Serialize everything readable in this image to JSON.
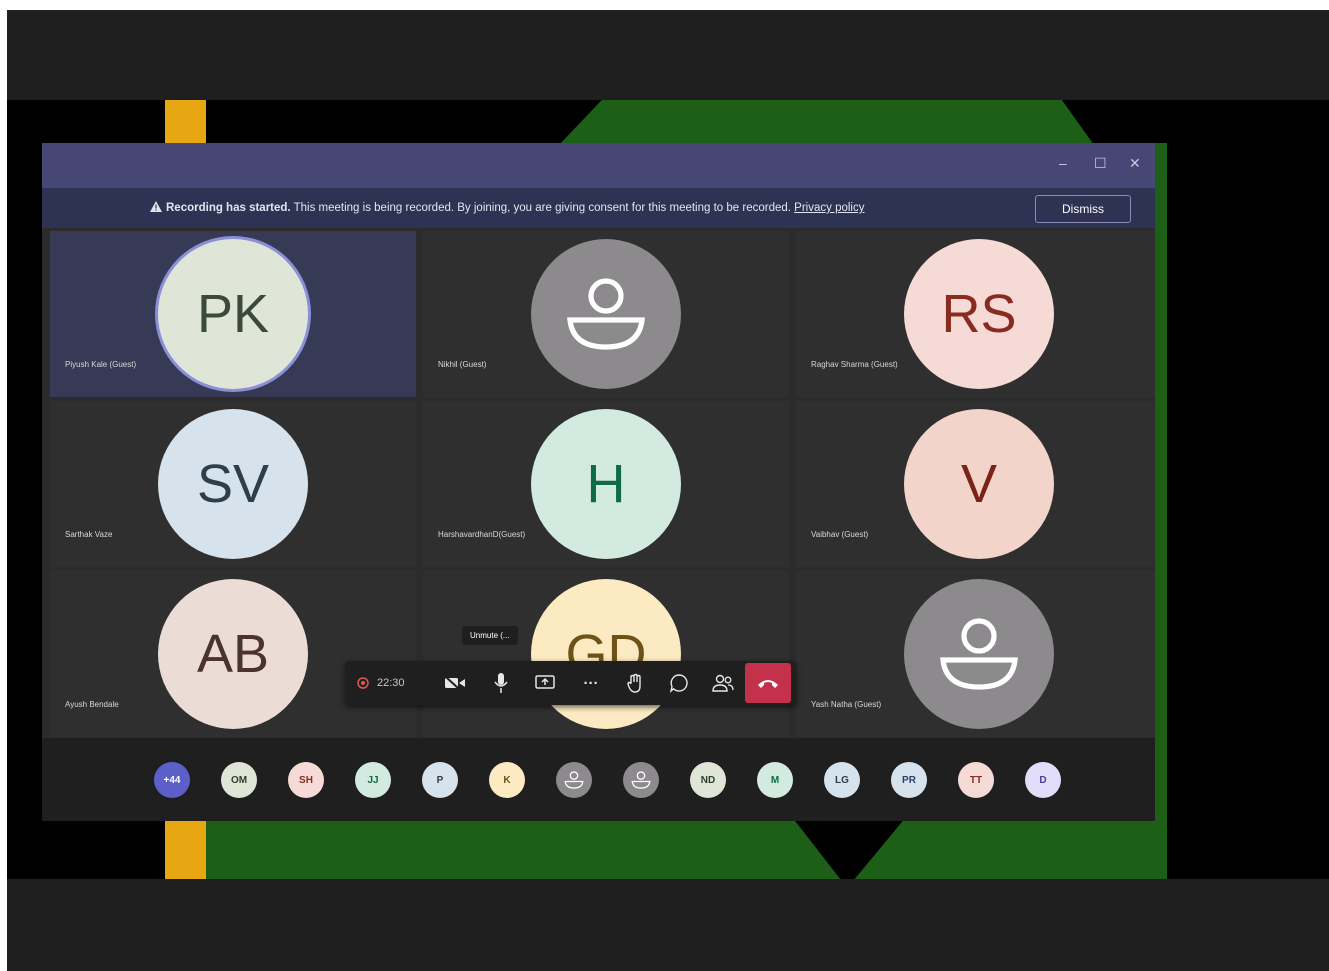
{
  "window": {
    "controls": {
      "minimize": "–",
      "maximize": "☐",
      "close": "✕"
    }
  },
  "banner": {
    "icon": "warning-icon",
    "title": "Recording has started.",
    "message": "This meeting is being recorded. By joining, you are giving consent for this meeting to be recorded.",
    "link": "Privacy policy",
    "dismiss_label": "Dismiss"
  },
  "participants": [
    {
      "initials": "PK",
      "name": "Piyush Kale (Guest)",
      "bg": "#dfe6d7",
      "fg": "#3c4a3c",
      "speaking": true
    },
    {
      "initials": "",
      "name": "Nikhil (Guest)",
      "bg": "#8c8a8c",
      "fg": "#ffffff",
      "icon": "person-icon"
    },
    {
      "initials": "RS",
      "name": "Raghav Sharma (Guest)",
      "bg": "#f6dad5",
      "fg": "#8a2b21"
    },
    {
      "initials": "SV",
      "name": "Sarthak Vaze",
      "bg": "#d7e3ec",
      "fg": "#2e3e4a"
    },
    {
      "initials": "H",
      "name": "HarshavardhanD(Guest)",
      "bg": "#d2eadf",
      "fg": "#0f6b45"
    },
    {
      "initials": "V",
      "name": "Vaibhav (Guest)",
      "bg": "#f2d4ca",
      "fg": "#7a2416"
    },
    {
      "initials": "AB",
      "name": "Ayush Bendale",
      "bg": "#ebdcd6",
      "fg": "#4b342b"
    },
    {
      "initials": "GD",
      "name": "",
      "bg": "#fbeac2",
      "fg": "#6e5218"
    },
    {
      "initials": "",
      "name": "Yash Natha (Guest)",
      "bg": "#8c8a8c",
      "fg": "#ffffff",
      "icon": "person-icon"
    }
  ],
  "toolbar": {
    "timer": "22:30",
    "tooltip": "Unmute (...",
    "buttons": [
      "camera-icon",
      "mic-icon",
      "share-screen-icon",
      "more-icon",
      "raise-hand-icon",
      "chat-icon",
      "participants-icon",
      "hangup-icon"
    ],
    "more_label": "···"
  },
  "strip": [
    {
      "label": "+44",
      "bg": "#5b5fc7",
      "fg": "#ffffff"
    },
    {
      "label": "OM",
      "bg": "#dfe6d7",
      "fg": "#2e3e2e"
    },
    {
      "label": "SH",
      "bg": "#f6dad5",
      "fg": "#8a2b21"
    },
    {
      "label": "JJ",
      "bg": "#d2eadf",
      "fg": "#0f6b45"
    },
    {
      "label": "P",
      "bg": "#d7e3ec",
      "fg": "#2e3e4a"
    },
    {
      "label": "K",
      "bg": "#fbeac2",
      "fg": "#6e5218"
    },
    {
      "label": "",
      "bg": "#8c8a8c",
      "fg": "#ffffff",
      "icon": "person-icon"
    },
    {
      "label": "",
      "bg": "#8c8a8c",
      "fg": "#ffffff",
      "icon": "person-icon"
    },
    {
      "label": "ND",
      "bg": "#dfe6d7",
      "fg": "#2e3e2e"
    },
    {
      "label": "M",
      "bg": "#d2eadf",
      "fg": "#0f6b45"
    },
    {
      "label": "LG",
      "bg": "#d7e3ec",
      "fg": "#2e3e4a"
    },
    {
      "label": "PR",
      "bg": "#d7e3ec",
      "fg": "#2e3e6a"
    },
    {
      "label": "TT",
      "bg": "#f6dad5",
      "fg": "#8a2b21"
    },
    {
      "label": "D",
      "bg": "#e2defa",
      "fg": "#4a3e8a"
    }
  ]
}
